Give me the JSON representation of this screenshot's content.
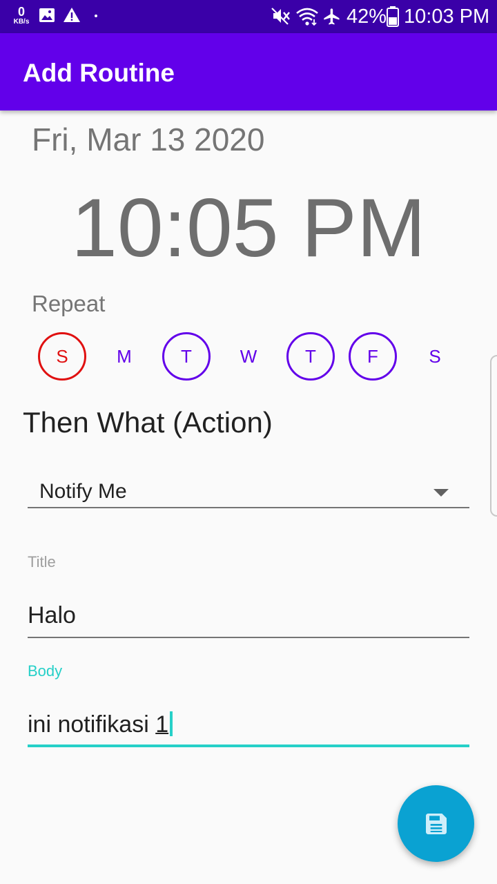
{
  "status_bar": {
    "net_speed": "0",
    "net_unit": "KB/s",
    "battery": "42%",
    "time": "10:03 PM",
    "icons": [
      "image-icon",
      "warning-icon",
      "dot-icon",
      "mute-icon",
      "wifi-icon",
      "airplane-icon",
      "battery-icon"
    ]
  },
  "app_bar": {
    "title": "Add Routine"
  },
  "schedule": {
    "date": "Fri, Mar 13 2020",
    "time": "10:05 PM"
  },
  "repeat": {
    "label": "Repeat",
    "days": [
      {
        "letter": "S",
        "state": "today"
      },
      {
        "letter": "M",
        "state": "off"
      },
      {
        "letter": "T",
        "state": "on"
      },
      {
        "letter": "W",
        "state": "off"
      },
      {
        "letter": "T",
        "state": "on"
      },
      {
        "letter": "F",
        "state": "on"
      },
      {
        "letter": "S",
        "state": "off"
      }
    ]
  },
  "action": {
    "heading": "Then What (Action)",
    "selected": "Notify Me"
  },
  "form": {
    "title_label": "Title",
    "title_value": "Halo",
    "body_label": "Body",
    "body_value_prefix": "ini notifikasi ",
    "body_value_last": "1"
  },
  "fab": {
    "icon": "save-icon"
  },
  "colors": {
    "status_bar": "#3a00a8",
    "primary": "#6200ea",
    "today_ring": "#e01010",
    "accent": "#26d0c8",
    "fab": "#0aa2d2"
  }
}
